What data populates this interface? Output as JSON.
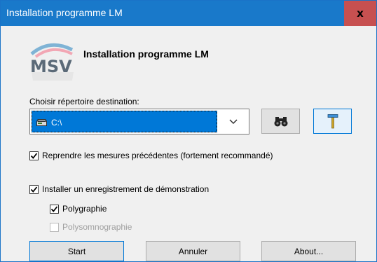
{
  "window": {
    "title": "Installation programme LM",
    "close_label": "x"
  },
  "header": {
    "title": "Installation programme LM",
    "logo_text": "MSV"
  },
  "destination": {
    "label": "Choisir répertoire destination:",
    "selected_value": "C:\\"
  },
  "options": {
    "reprendre": {
      "label": "Reprendre les mesures précédentes (fortement recommandé)",
      "checked": true
    },
    "installer": {
      "label": "Installer un enregistrement de démonstration",
      "checked": true
    },
    "polygraphie": {
      "label": "Polygraphie",
      "checked": true
    },
    "polysomnographie": {
      "label": "Polysomnographie",
      "checked": false,
      "enabled": false
    }
  },
  "buttons": {
    "start": "Start",
    "annuler": "Annuler",
    "about": "About..."
  },
  "colors": {
    "titlebar": "#1979ca",
    "close": "#c75050",
    "selection": "#0078d7"
  }
}
